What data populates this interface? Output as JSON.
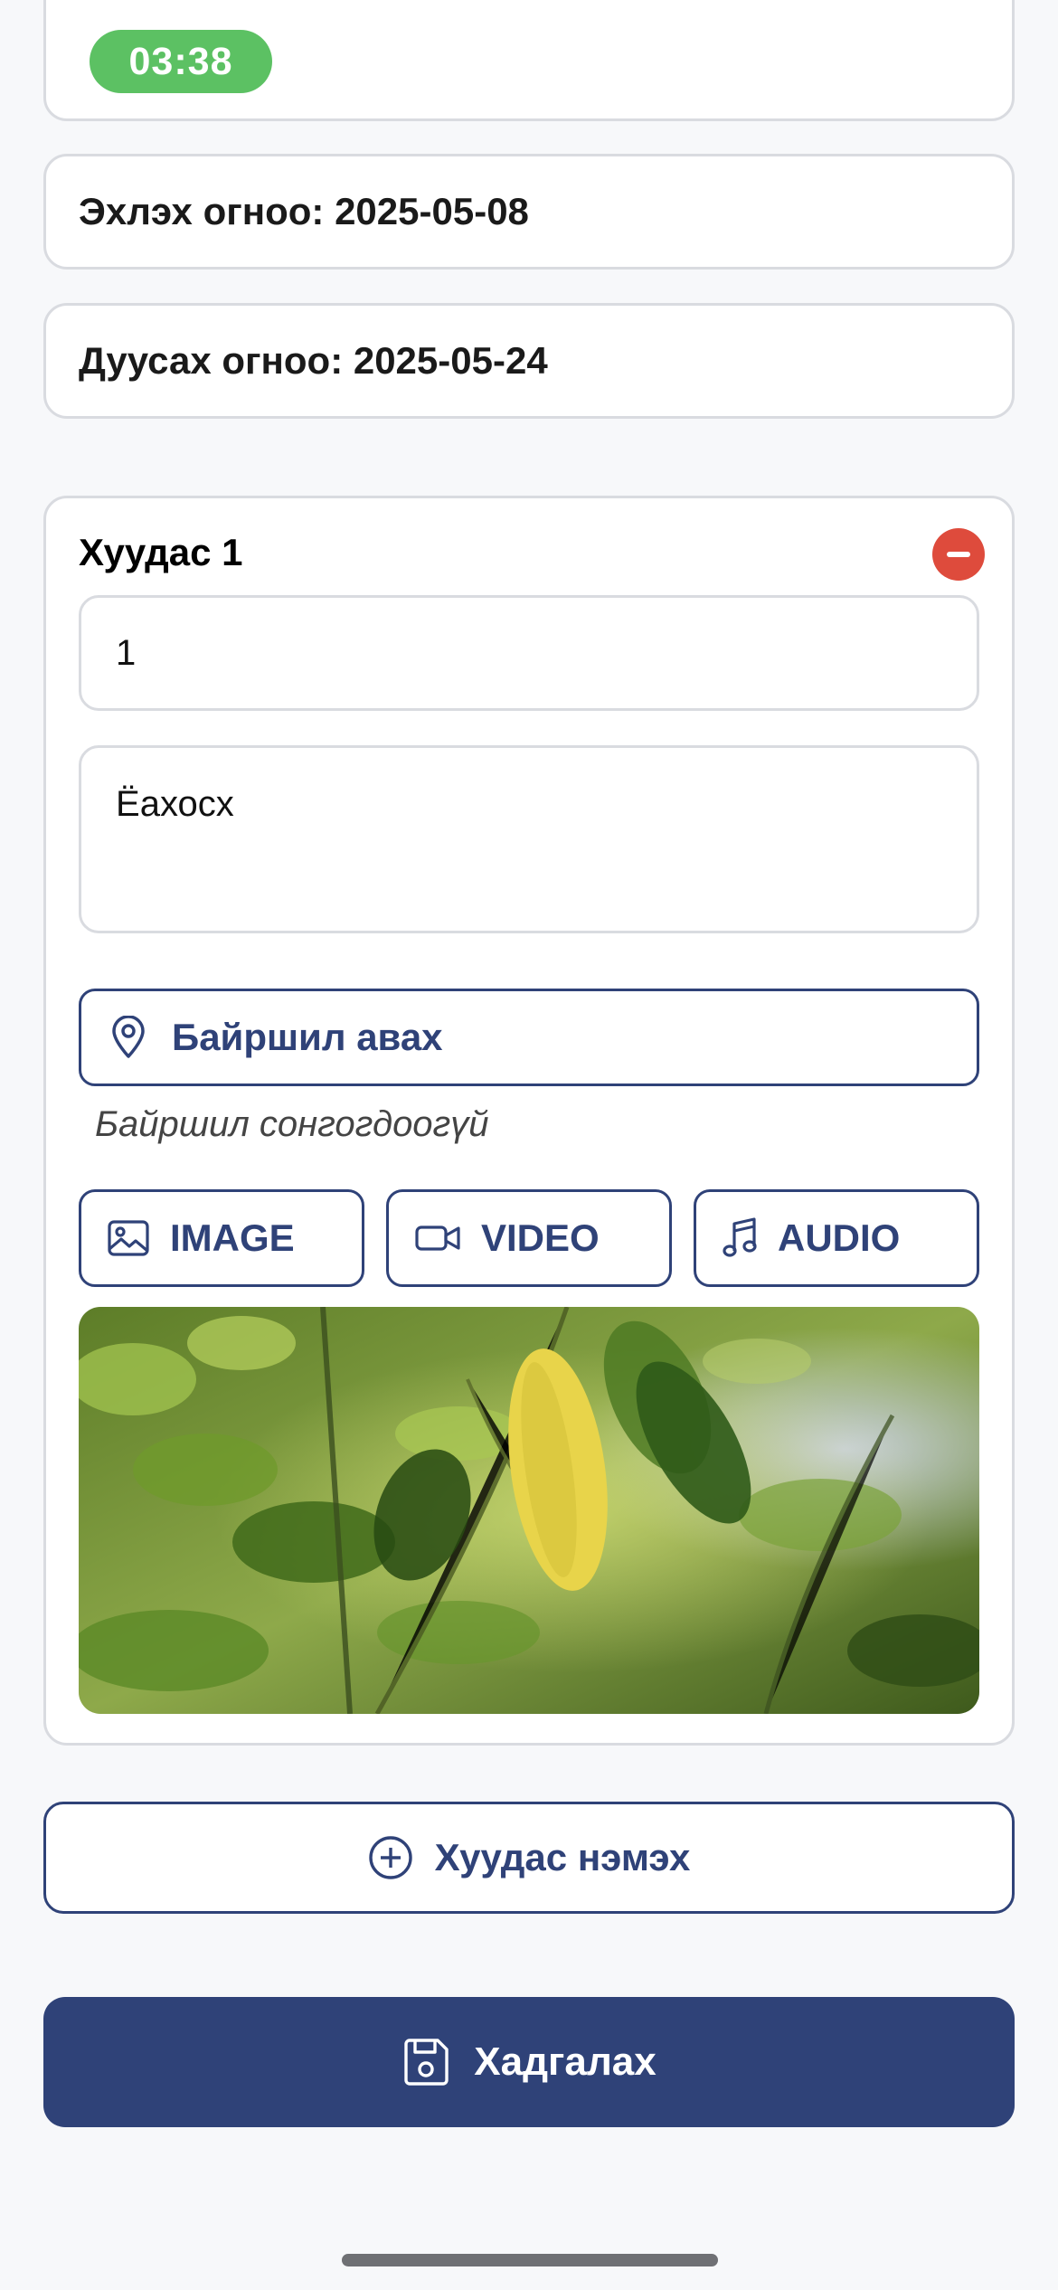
{
  "timer": {
    "value": "03:38",
    "color": "#5cc163"
  },
  "dates": {
    "start": "Эхлэх огноо: 2025-05-08",
    "end": "Дуусах огноо: 2025-05-24"
  },
  "page_section": {
    "title": "Хуудас 1",
    "number_value": "1",
    "text_value": "Ёахосх",
    "location_button": "Байршил авах",
    "location_status": "Байршил сонгогдоогүй",
    "media_buttons": {
      "image": "IMAGE",
      "video": "VIDEO",
      "audio": "AUDIO"
    }
  },
  "actions": {
    "add_page": "Хуудас нэмэх",
    "save": "Хадгалах"
  },
  "colors": {
    "primary": "#2f4278",
    "danger": "#de4b3c",
    "success": "#5cc163",
    "background": "#f7f8fa"
  }
}
